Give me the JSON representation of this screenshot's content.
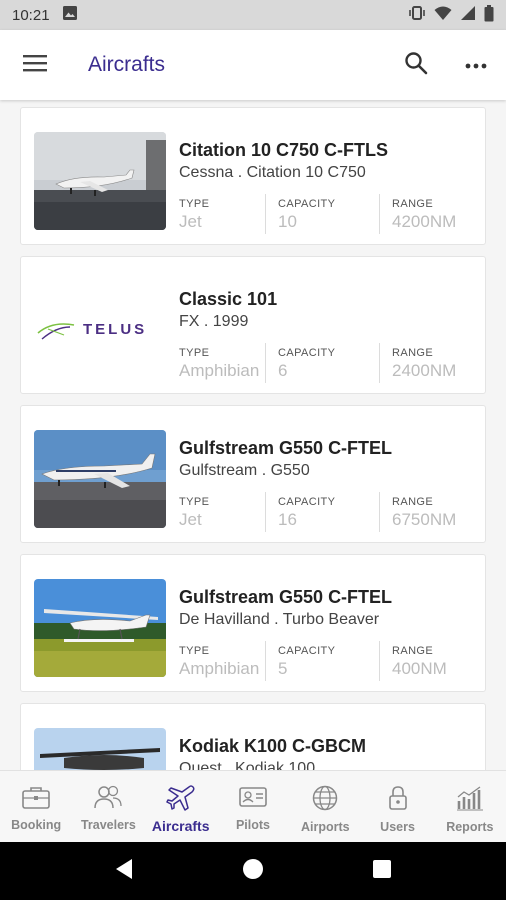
{
  "status_bar": {
    "time": "10:21",
    "icons": [
      "image-icon",
      "vibrate-icon",
      "wifi-icon",
      "signal-icon",
      "battery-icon"
    ]
  },
  "app_bar": {
    "title": "Aircrafts",
    "icons": [
      "menu-icon",
      "search-icon",
      "more-icon"
    ]
  },
  "colors": {
    "accent": "#3b2d8f",
    "value_text": "#bcbcbc",
    "status_bar_bg": "#d9d9d9"
  },
  "aircrafts": [
    {
      "name": "Citation 10 C750 C-FTLS",
      "subtitle": "Cessna . Citation 10 C750",
      "type_label": "TYPE",
      "type": "Jet",
      "capacity_label": "CAPACITY",
      "capacity": "10",
      "range_label": "RANGE",
      "range": "4200NM"
    },
    {
      "name": "Classic 101",
      "subtitle": "FX . 1999",
      "type_label": "TYPE",
      "type": "Amphibian",
      "capacity_label": "CAPACITY",
      "capacity": "6",
      "range_label": "RANGE",
      "range": "2400NM",
      "logo_text": "TELUS"
    },
    {
      "name": "Gulfstream G550 C-FTEL",
      "subtitle": "Gulfstream . G550",
      "type_label": "TYPE",
      "type": "Jet",
      "capacity_label": "CAPACITY",
      "capacity": "16",
      "range_label": "RANGE",
      "range": "6750NM"
    },
    {
      "name": "Gulfstream G550 C-FTEL",
      "subtitle": "De Havilland . Turbo Beaver",
      "type_label": "TYPE",
      "type": "Amphibian",
      "capacity_label": "CAPACITY",
      "capacity": "5",
      "range_label": "RANGE",
      "range": "400NM"
    },
    {
      "name": "Kodiak K100 C-GBCM",
      "subtitle": "Quest . Kodiak 100"
    }
  ],
  "bottom_nav": [
    {
      "label": "Booking",
      "icon": "briefcase-icon"
    },
    {
      "label": "Travelers",
      "icon": "people-icon"
    },
    {
      "label": "Aircrafts",
      "icon": "plane-icon",
      "active": true
    },
    {
      "label": "Pilots",
      "icon": "id-card-icon"
    },
    {
      "label": "Airports",
      "icon": "globe-icon"
    },
    {
      "label": "Users",
      "icon": "lock-icon"
    },
    {
      "label": "Reports",
      "icon": "bar-chart-icon"
    }
  ]
}
